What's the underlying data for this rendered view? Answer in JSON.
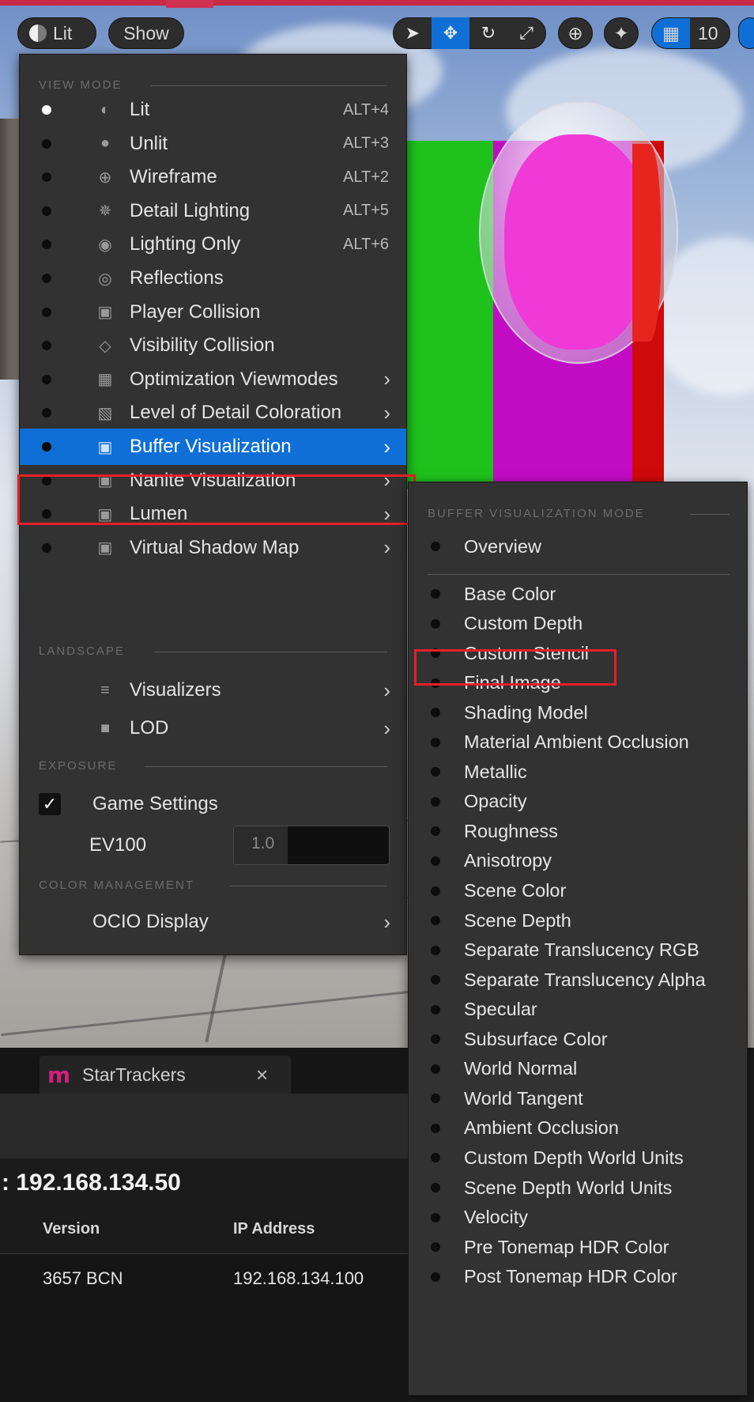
{
  "toolbar": {
    "view_mode_label": "Lit",
    "show_label": "Show",
    "grid_snap_value": "10"
  },
  "menu": {
    "sections": {
      "view_mode": "VIEW MODE",
      "landscape": "LANDSCAPE",
      "exposure": "EXPOSURE",
      "color_management": "COLOR MANAGEMENT"
    },
    "view_modes": [
      {
        "label": "Lit",
        "shortcut": "ALT+4",
        "icon": "sphere-lit-icon",
        "selected": true
      },
      {
        "label": "Unlit",
        "shortcut": "ALT+3",
        "icon": "sphere-unlit-icon"
      },
      {
        "label": "Wireframe",
        "shortcut": "ALT+2",
        "icon": "wireframe-globe-icon"
      },
      {
        "label": "Detail Lighting",
        "shortcut": "ALT+5",
        "icon": "detail-lighting-icon"
      },
      {
        "label": "Lighting Only",
        "shortcut": "ALT+6",
        "icon": "lightbulb-icon"
      },
      {
        "label": "Reflections",
        "icon": "reflections-icon"
      },
      {
        "label": "Player Collision",
        "icon": "player-collision-icon"
      },
      {
        "label": "Visibility Collision",
        "icon": "visibility-collision-icon"
      },
      {
        "label": "Optimization Viewmodes",
        "icon": "optimization-grid-icon",
        "submenu": true
      },
      {
        "label": "Level of Detail Coloration",
        "icon": "lod-coloration-icon",
        "submenu": true
      },
      {
        "label": "Buffer Visualization",
        "icon": "buffer-grid-icon",
        "submenu": true,
        "highlighted": true
      },
      {
        "label": "Nanite Visualization",
        "icon": "nanite-grid-icon",
        "submenu": true
      },
      {
        "label": "Lumen",
        "icon": "lumen-grid-icon",
        "submenu": true
      },
      {
        "label": "Virtual Shadow Map",
        "icon": "shadow-map-grid-icon",
        "submenu": true
      }
    ],
    "landscape_items": [
      {
        "label": "Visualizers",
        "icon": "visualizers-icon"
      },
      {
        "label": "LOD",
        "icon": "lod-icon"
      }
    ],
    "exposure": {
      "game_settings_label": "Game Settings",
      "game_settings_checked": true,
      "ev100_label": "EV100",
      "ev100_value": "1.0"
    },
    "ocio_label": "OCIO Display"
  },
  "submenu": {
    "title": "BUFFER VISUALIZATION MODE",
    "overview": "Overview",
    "items": [
      "Base Color",
      "Custom Depth",
      "Custom Stencil",
      "Final Image",
      "Shading Model",
      "Material Ambient Occlusion",
      "Metallic",
      "Opacity",
      "Roughness",
      "Anisotropy",
      "Scene Color",
      "Scene Depth",
      "Separate Translucency RGB",
      "Separate Translucency Alpha",
      "Specular",
      "Subsurface Color",
      "World Normal",
      "World Tangent",
      "Ambient Occlusion",
      "Custom Depth World Units",
      "Scene Depth World Units",
      "Velocity",
      "Pre Tonemap HDR Color",
      "Post Tonemap HDR Color"
    ],
    "highlighted_item": "Custom Stencil"
  },
  "panel": {
    "tab_label": "StarTrackers",
    "tab_close": "×",
    "address_title": ": 192.168.134.50",
    "columns": [
      "Version",
      "IP Address"
    ],
    "rows": [
      [
        "3657 BCN",
        "192.168.134.100"
      ]
    ]
  },
  "colors": {
    "accent": "#0f6fd6",
    "highlight_box": "#e3202a",
    "tab_logo": "#d1207e"
  }
}
